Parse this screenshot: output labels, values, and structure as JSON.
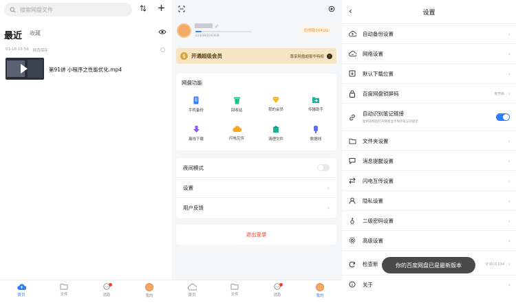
{
  "files": {
    "search_placeholder": "搜索网盘文件",
    "recent_label": "最近",
    "favorites_label": "收藏",
    "record_time": "03-18 13:59",
    "record_source": "网页保存",
    "file_name": "第91讲 小程序之性能优化.mp4"
  },
  "tabbar": {
    "home": "首页",
    "files": "文件",
    "messages": "消息",
    "mine": "我的"
  },
  "profile": {
    "storage_used": "233GB/2163GB",
    "storage_fraction": 0.11,
    "space_badge": "仍领取1041G",
    "vip_title": "开通超级会员",
    "vip_subtitle": "尊享网盘超豪华特权"
  },
  "features": {
    "title": "网盘功能",
    "items": [
      {
        "label": "手机备份"
      },
      {
        "label": "回收站"
      },
      {
        "label": "我的会员"
      },
      {
        "label": "传输助手"
      },
      {
        "label": "离线下载"
      },
      {
        "label": "闪电互传"
      },
      {
        "label": "清理文件"
      },
      {
        "label": "数据线"
      }
    ]
  },
  "mine_settings": {
    "night_mode": "夜间模式",
    "settings": "设置",
    "feedback": "用户反馈",
    "logout": "退出登录",
    "night_mode_on": false
  },
  "settings_page": {
    "title": "设置",
    "rows": [
      {
        "label": "自动备份设置"
      },
      {
        "label": "网络设置"
      },
      {
        "label": "默认下载位置"
      },
      {
        "label": "百度网盘锁屏码",
        "value": "未开启"
      },
      {
        "label": "自动识别笔记链接",
        "sub": "复制链接后打开网盘显示保存笔记的提示",
        "toggle_on": true
      },
      {
        "label": "文件夹设置"
      },
      {
        "label": "消息提醒设置"
      },
      {
        "label": "闪电互传设置"
      },
      {
        "label": "隐私设置"
      },
      {
        "label": "二级密码设置"
      },
      {
        "label": "高级设置"
      },
      {
        "label": "检查新",
        "value": "V 10.0.134"
      },
      {
        "label": "关于"
      }
    ],
    "toast": "你的百度网盘已是最新版本"
  },
  "colors": {
    "accent": "#2d7ff9",
    "danger": "#e8443b",
    "vip_bg": "#f5e5c4"
  }
}
